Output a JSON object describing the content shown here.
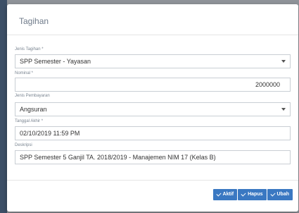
{
  "modal": {
    "title": "Tagihan"
  },
  "form": {
    "jenis_tagihan": {
      "label": "Jenis Tagihan *",
      "value": "SPP Semester - Yayasan"
    },
    "nominal": {
      "label": "Nominal *",
      "value": "2000000"
    },
    "jenis_pembayaran": {
      "label": "Jenis Pembayaran",
      "value": "Angsuran"
    },
    "tanggal_akhir": {
      "label": "Tanggal Akhir *",
      "value": "02/10/2019 11:59 PM"
    },
    "deskripsi": {
      "label": "Deskripsi",
      "value": "SPP Semester 5 Ganjil TA. 2018/2019 - Manajemen NIM 17 (Kelas B)"
    }
  },
  "footer": {
    "aktif_label": "Aktif",
    "hapus_label": "Hapus",
    "ubah_label": "Ubah"
  },
  "colors": {
    "primary": "#3a78c2",
    "backdrop": "#8f9399"
  }
}
